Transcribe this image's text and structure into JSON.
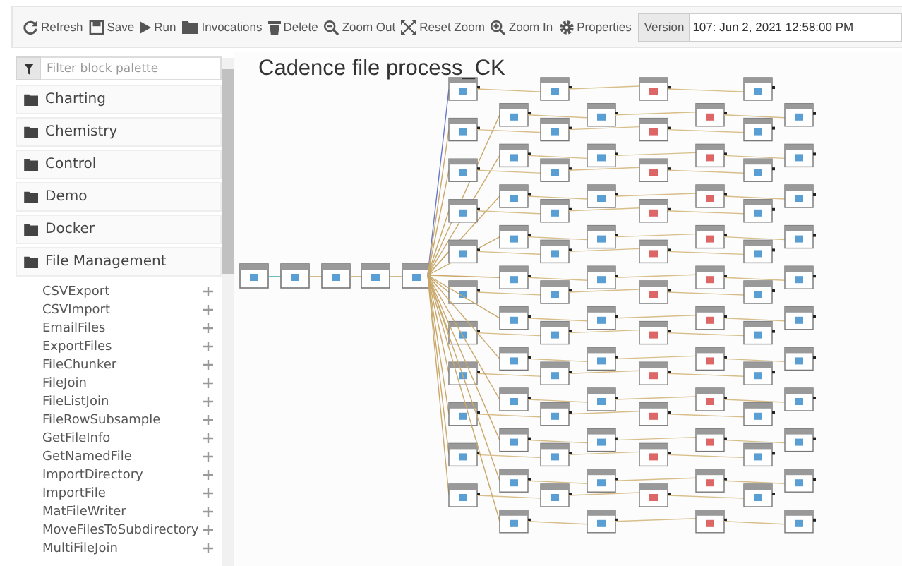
{
  "toolbar": {
    "buttons": [
      "Refresh",
      "Save",
      "Run",
      "Invocations",
      "Delete",
      "Zoom Out",
      "Reset Zoom",
      "Zoom In",
      "Properties"
    ],
    "version": {
      "label": "Version",
      "value": "107: Jun 2, 2021 12:58:00 PM"
    }
  },
  "palette": {
    "filter": {
      "placeholder": "Filter block palette"
    },
    "categories": [
      {
        "label": "Charting"
      },
      {
        "label": "Chemistry"
      },
      {
        "label": "Control"
      },
      {
        "label": "Demo"
      },
      {
        "label": "Docker"
      },
      {
        "label": "File Management",
        "items": [
          "CSVExport",
          "CSVImport",
          "EmailFiles",
          "ExportFiles",
          "FileChunker",
          "FileJoin",
          "FileListJoin",
          "FileRowSubsample",
          "GetFileInfo",
          "GetNamedFile",
          "ImportDirectory",
          "ImportFile",
          "MatFileWriter",
          "MoveFilesToSubdirectory",
          "MultiFileJoin"
        ]
      }
    ]
  },
  "canvas": {
    "title": "Cadence file process_CK"
  }
}
